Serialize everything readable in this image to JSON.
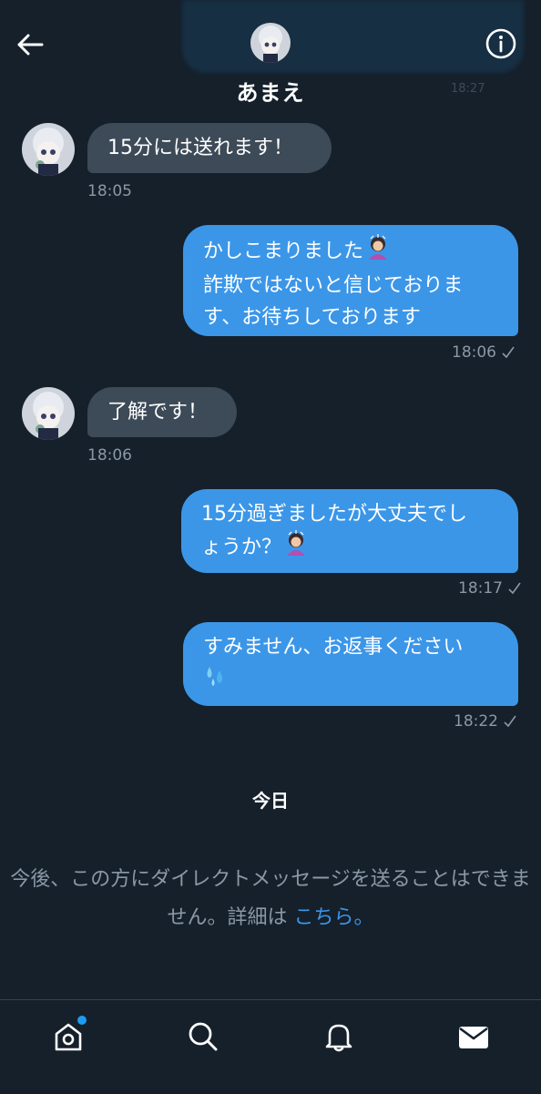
{
  "header": {
    "contact_name": "あまえ",
    "back_icon": "arrow-left-icon",
    "info_icon": "info-icon"
  },
  "background_partial": {
    "time": "18:27"
  },
  "messages": [
    {
      "direction": "in",
      "lines": [
        "15分には送れます！"
      ],
      "time": "18:05"
    },
    {
      "direction": "out",
      "lines": [
        "かしこまりました",
        "詐欺ではないと信じておりま",
        "す、お待ちしております"
      ],
      "emoji": "person-bowing-emoji",
      "time": "18:06"
    },
    {
      "direction": "in",
      "lines": [
        "了解です！"
      ],
      "time": "18:06"
    },
    {
      "direction": "out",
      "lines": [
        "15分過ぎましたが大丈夫でし",
        "ょうか？"
      ],
      "emoji": "person-bowing-emoji",
      "time": "18:17"
    },
    {
      "direction": "out",
      "lines": [
        "すみません、お返事ください"
      ],
      "emoji": "sweat-droplets-emoji",
      "time": "18:22"
    }
  ],
  "day_separator": "今日",
  "notice": {
    "text": "今後、この方にダイレクトメッセージを送ることはできません。詳細は",
    "link": "こちら",
    "end": "。"
  },
  "nav": {
    "items": [
      "home-icon",
      "search-icon",
      "bell-icon",
      "mail-icon"
    ],
    "home_has_badge": true
  },
  "colors": {
    "background": "#15202b",
    "bubble_out": "#3b96e8",
    "bubble_in": "#3d4a57",
    "meta_text": "#8b98a5",
    "link": "#3b96e8"
  }
}
